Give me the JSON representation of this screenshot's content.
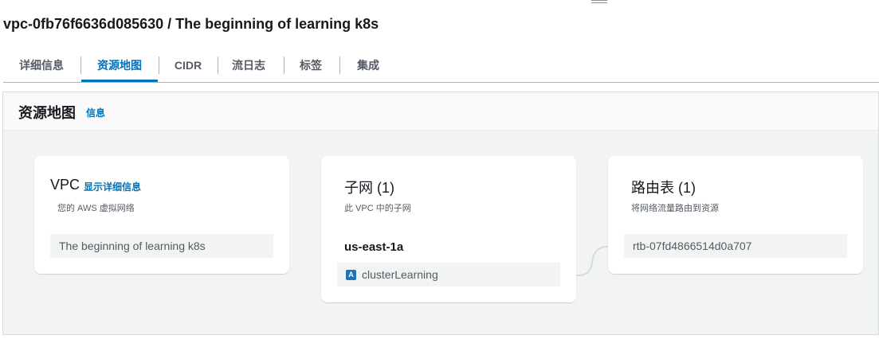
{
  "page": {
    "title": "vpc-0fb76f6636d085630 / The beginning of learning k8s"
  },
  "tabs": [
    {
      "label": "详细信息",
      "active": false
    },
    {
      "label": "资源地图",
      "active": true
    },
    {
      "label": "CIDR",
      "active": false
    },
    {
      "label": "流日志",
      "active": false
    },
    {
      "label": "标签",
      "active": false
    },
    {
      "label": "集成",
      "active": false
    }
  ],
  "resource_map": {
    "title": "资源地图",
    "info_link": "信息",
    "vpc": {
      "title": "VPC",
      "details_link": "显示详细信息",
      "description": "您的 AWS 虚拟网络",
      "name": "The beginning of learning k8s"
    },
    "subnets": {
      "title": "子网 (1)",
      "description": "此 VPC 中的子网",
      "availability_zone": "us-east-1a",
      "items": [
        {
          "icon_letter": "A",
          "name": "clusterLearning"
        }
      ]
    },
    "route_tables": {
      "title": "路由表 (1)",
      "description": "将网络流量路由到资源",
      "items": [
        {
          "name": "rtb-07fd4866514d0a707"
        }
      ]
    }
  },
  "colors": {
    "accent": "#0073bb",
    "connector": "#d5dbdb",
    "subnet_icon": "#1f73b7"
  }
}
